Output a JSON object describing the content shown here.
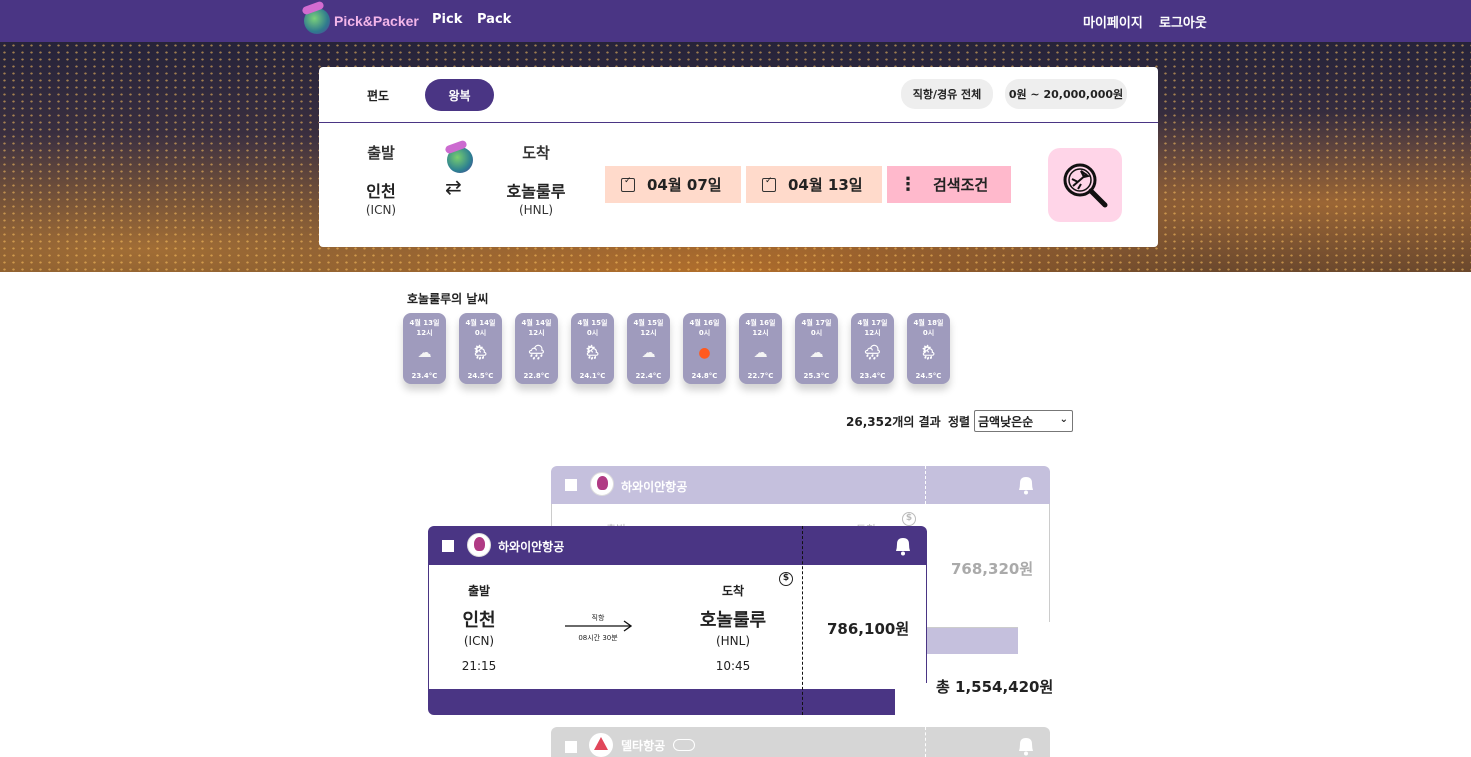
{
  "nav": {
    "logo_text": "Pick&Packer",
    "links": [
      "Pick",
      "Pack"
    ],
    "right_links": [
      "마이페이지",
      "로그아웃"
    ]
  },
  "search": {
    "trip_types": [
      "편도",
      "왕복"
    ],
    "selected_trip_type": "왕복",
    "filter_stops": "직항/경유 전체",
    "filter_price": "0원 ~ 20,000,000원",
    "departure_label": "출발",
    "arrival_label": "도착",
    "departure_city": "인천",
    "departure_code": "(ICN)",
    "arrival_city": "호놀룰루",
    "arrival_code": "(HNL)",
    "swap_icon": "swap-arrows-icon",
    "date_out": "04월 07일",
    "date_return": "04월 13일",
    "conditions_label": "검색조건",
    "search_icon": "plane-magnifier-icon"
  },
  "weather": {
    "title": "호놀룰루의 날씨",
    "items": [
      {
        "date": "4월 13일",
        "time": "12시",
        "icon": "cloud-icon",
        "temp": "23.4°C"
      },
      {
        "date": "4월 14일",
        "time": "0시",
        "icon": "rain-sun-icon",
        "temp": "24.5°C"
      },
      {
        "date": "4월 14일",
        "time": "12시",
        "icon": "rain-cloud-icon",
        "temp": "22.8°C"
      },
      {
        "date": "4월 15일",
        "time": "0시",
        "icon": "rain-sun-icon",
        "temp": "24.1°C"
      },
      {
        "date": "4월 15일",
        "time": "12시",
        "icon": "cloud-icon",
        "temp": "22.4°C"
      },
      {
        "date": "4월 16일",
        "time": "0시",
        "icon": "sun-icon",
        "temp": "24.8°C"
      },
      {
        "date": "4월 16일",
        "time": "12시",
        "icon": "cloud-icon",
        "temp": "22.7°C"
      },
      {
        "date": "4월 17일",
        "time": "0시",
        "icon": "cloud-icon",
        "temp": "25.3°C"
      },
      {
        "date": "4월 17일",
        "time": "12시",
        "icon": "rain-cloud-icon",
        "temp": "23.4°C"
      },
      {
        "date": "4월 18일",
        "time": "0시",
        "icon": "rain-sun-icon",
        "temp": "24.5°C"
      }
    ]
  },
  "results": {
    "count": "26,352개의 결과",
    "sort_label": "정렬",
    "sort_selected": "금액낮은순"
  },
  "tickets": {
    "back": {
      "airline": "하와이안항공",
      "price": "768,320원",
      "ghost_departure": "출발",
      "ghost_arrival": "도착"
    },
    "front": {
      "airline": "하와이안항공",
      "departure_label": "출발",
      "arrival_label": "도착",
      "departure_city": "인천",
      "departure_code": "(ICN)",
      "departure_time": "21:15",
      "arrival_city": "호놀룰루",
      "arrival_code": "(HNL)",
      "arrival_time": "10:45",
      "route_type": "직항",
      "duration": "08시간 30분",
      "price": "786,100원"
    },
    "total": "총 1,554,420원",
    "next_airline": "델타항공"
  }
}
